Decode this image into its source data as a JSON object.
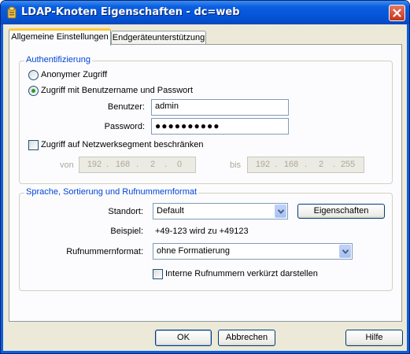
{
  "window": {
    "title": "LDAP-Knoten Eigenschaften - dc=web",
    "icons": {
      "app": "ldap-node-icon",
      "close": "close-icon"
    }
  },
  "tabs": [
    {
      "label": "Allgemeine Einstellungen",
      "active": true
    },
    {
      "label": "Endgeräteunterstützung",
      "active": false
    }
  ],
  "auth": {
    "group_title": "Authentifizierung",
    "option_anonymous": "Anonymer Zugriff",
    "option_credentials": "Zugriff mit Benutzername und Passwort",
    "selected": "credentials",
    "user_label": "Benutzer:",
    "user_value": "admin",
    "password_label": "Password:",
    "password_value": "●●●●●●●●●●",
    "restrict_label": "Zugriff auf Netzwerksegment beschränken",
    "restrict_checked": false,
    "from_label": "von",
    "from_ip": [
      "192",
      "168",
      "2",
      "0"
    ],
    "to_label": "bis",
    "to_ip": [
      "192",
      "168",
      "2",
      "255"
    ]
  },
  "locale": {
    "group_title": "Sprache, Sortierung und Rufnummernformat",
    "location_label": "Standort:",
    "location_value": "Default",
    "properties_button": "Eigenschaften",
    "example_label": "Beispiel:",
    "example_value": "+49-123 wird zu +49123",
    "format_label": "Rufnummernformat:",
    "format_value": "ohne Formatierung",
    "short_internal_label": "Interne Rufnummern verkürzt darstellen",
    "short_internal_checked": false
  },
  "buttons": {
    "ok": "OK",
    "cancel": "Abbrechen",
    "help": "Hilfe"
  }
}
